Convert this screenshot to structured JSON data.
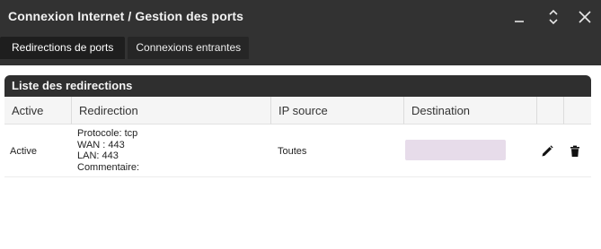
{
  "window": {
    "title": "Connexion Internet / Gestion des ports",
    "controls": {
      "minimize_icon": "minimize-icon",
      "maximize_icon": "expand-icon",
      "close_icon": "close-icon"
    }
  },
  "tabs": [
    {
      "label": "Redirections de ports",
      "active": true
    },
    {
      "label": "Connexions entrantes",
      "active": false
    }
  ],
  "panel": {
    "title": "Liste des redirections"
  },
  "table": {
    "headers": {
      "active": "Active",
      "redirection": "Redirection",
      "ip_source": "IP source",
      "destination": "Destination"
    },
    "rows": [
      {
        "active": "Active",
        "redirection": {
          "protocole": "Protocole: tcp",
          "wan": "WAN : 443",
          "lan": "LAN: 443",
          "commentaire": "Commentaire:"
        },
        "ip_source": "Toutes",
        "destination_redacted": true,
        "edit_icon": "pencil-icon",
        "delete_icon": "trash-icon"
      }
    ]
  },
  "colors": {
    "titlebar": "#323232",
    "panel_header": "#2f2f2f",
    "header_row": "#f5f5f5",
    "redacted_fill": "#e7dcea"
  }
}
